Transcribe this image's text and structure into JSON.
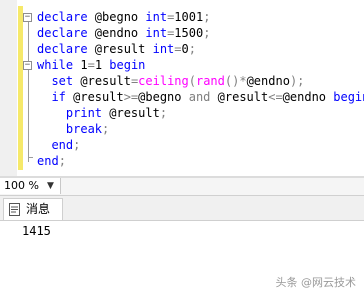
{
  "editor": {
    "lines": [
      [
        {
          "t": "declare",
          "c": "kw"
        },
        {
          "t": " @begno ",
          "c": ""
        },
        {
          "t": "int",
          "c": "kw"
        },
        {
          "t": "=",
          "c": "op"
        },
        {
          "t": "1001",
          "c": ""
        },
        {
          "t": ";",
          "c": "op"
        }
      ],
      [
        {
          "t": "declare",
          "c": "kw"
        },
        {
          "t": " @endno ",
          "c": ""
        },
        {
          "t": "int",
          "c": "kw"
        },
        {
          "t": "=",
          "c": "op"
        },
        {
          "t": "1500",
          "c": ""
        },
        {
          "t": ";",
          "c": "op"
        }
      ],
      [
        {
          "t": "declare",
          "c": "kw"
        },
        {
          "t": " @result ",
          "c": ""
        },
        {
          "t": "int",
          "c": "kw"
        },
        {
          "t": "=",
          "c": "op"
        },
        {
          "t": "0",
          "c": ""
        },
        {
          "t": ";",
          "c": "op"
        }
      ],
      [
        {
          "t": "while",
          "c": "kw"
        },
        {
          "t": " 1",
          "c": ""
        },
        {
          "t": "=",
          "c": "op"
        },
        {
          "t": "1 ",
          "c": ""
        },
        {
          "t": "begin",
          "c": "kw"
        }
      ],
      [
        {
          "t": "  ",
          "c": ""
        },
        {
          "t": "set",
          "c": "kw"
        },
        {
          "t": " @result",
          "c": ""
        },
        {
          "t": "=",
          "c": "op"
        },
        {
          "t": "ceiling",
          "c": "fn"
        },
        {
          "t": "(",
          "c": "op"
        },
        {
          "t": "rand",
          "c": "fn"
        },
        {
          "t": "()",
          "c": "op"
        },
        {
          "t": "*",
          "c": "op"
        },
        {
          "t": "@endno",
          "c": ""
        },
        {
          "t": ");",
          "c": "op"
        }
      ],
      [
        {
          "t": "  ",
          "c": ""
        },
        {
          "t": "if",
          "c": "kw"
        },
        {
          "t": " @result",
          "c": ""
        },
        {
          "t": ">=",
          "c": "op"
        },
        {
          "t": "@begno ",
          "c": ""
        },
        {
          "t": "and",
          "c": "op"
        },
        {
          "t": " @result",
          "c": ""
        },
        {
          "t": "<=",
          "c": "op"
        },
        {
          "t": "@endno ",
          "c": ""
        },
        {
          "t": "begin",
          "c": "kw"
        }
      ],
      [
        {
          "t": "    ",
          "c": ""
        },
        {
          "t": "print",
          "c": "kw"
        },
        {
          "t": " @result",
          "c": ""
        },
        {
          "t": ";",
          "c": "op"
        }
      ],
      [
        {
          "t": "    ",
          "c": ""
        },
        {
          "t": "break",
          "c": "kw"
        },
        {
          "t": ";",
          "c": "op"
        }
      ],
      [
        {
          "t": "  ",
          "c": ""
        },
        {
          "t": "end",
          "c": "kw"
        },
        {
          "t": ";",
          "c": "op"
        }
      ],
      [
        {
          "t": "end",
          "c": "kw"
        },
        {
          "t": ";",
          "c": "op"
        }
      ]
    ]
  },
  "zoom": {
    "value": "100 %"
  },
  "results": {
    "tab_label": "消息",
    "message": "1415"
  },
  "watermark": "头条 @网云技术"
}
